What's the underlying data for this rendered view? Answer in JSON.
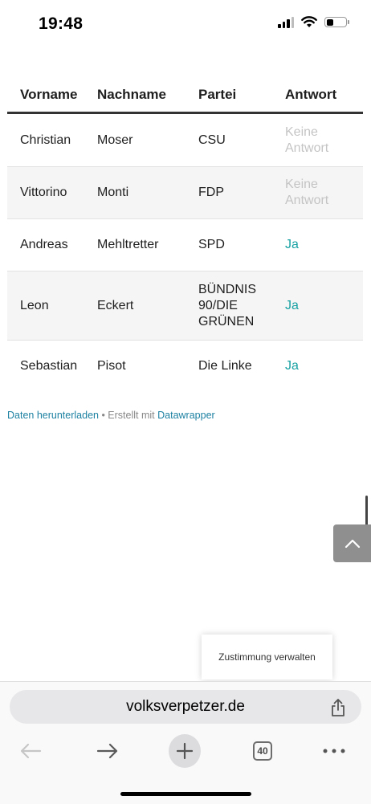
{
  "status_bar": {
    "time": "19:48",
    "battery_level": 0.35
  },
  "table": {
    "headers": [
      "Vorname",
      "Nachname",
      "Partei",
      "Antwort"
    ],
    "rows": [
      [
        "Christian",
        "Moser",
        "CSU",
        "Keine Antwort"
      ],
      [
        "Vittorino",
        "Monti",
        "FDP",
        "Keine Antwort"
      ],
      [
        "Andreas",
        "Mehltretter",
        "SPD",
        "Ja"
      ],
      [
        "Leon",
        "Eckert",
        "BÜNDNIS 90/DIE GRÜNEN",
        "Ja"
      ],
      [
        "Sebastian",
        "Pisot",
        "Die Linke",
        "Ja"
      ]
    ]
  },
  "credit": {
    "download_link": "Daten herunterladen",
    "separator": " • Erstellt mit ",
    "tool_link": "Datawrapper"
  },
  "consent": {
    "label": "Zustimmung verwalten"
  },
  "browser": {
    "url": "volksverpetzer.de",
    "tab_count": "40"
  },
  "colors": {
    "answer_yes": "#18a1a3",
    "answer_none": "#c4c4c4",
    "link": "#1d81a2"
  },
  "icons": [
    "cellular-icon",
    "wifi-icon",
    "battery-icon",
    "chevron-up-icon",
    "share-icon",
    "back-arrow-icon",
    "forward-arrow-icon",
    "plus-icon",
    "tabs-icon",
    "more-icon"
  ]
}
